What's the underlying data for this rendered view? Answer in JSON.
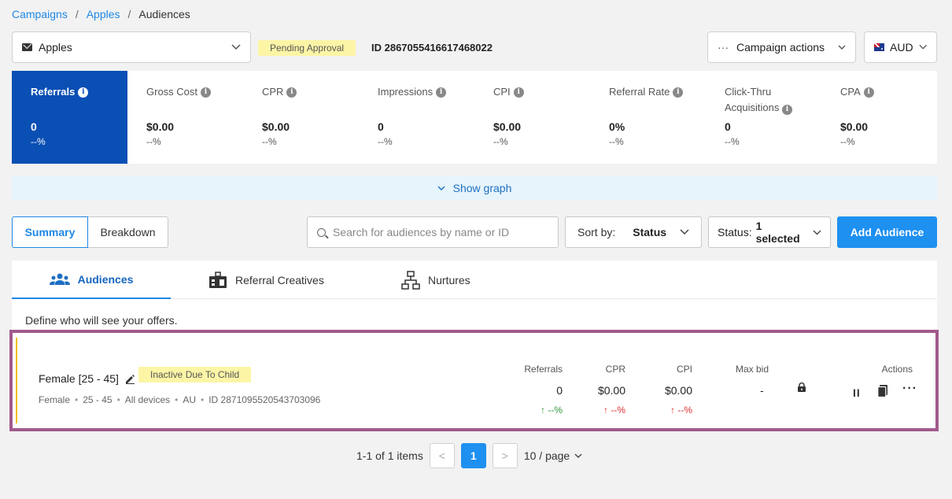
{
  "breadcrumb": {
    "item1": "Campaigns",
    "item2": "Apples",
    "item3": "Audiences",
    "sep": "/"
  },
  "header": {
    "campaign_name": "Apples",
    "status_badge": "Pending Approval",
    "campaign_id": "ID 2867055416617468022",
    "campaign_actions": "Campaign actions",
    "currency": "AUD",
    "more_glyph": "···"
  },
  "stats": [
    {
      "title": "Referrals",
      "value": "0",
      "delta": "--%"
    },
    {
      "title": "Gross Cost",
      "value": "$0.00",
      "delta": "--%"
    },
    {
      "title": "CPR",
      "value": "$0.00",
      "delta": "--%"
    },
    {
      "title": "Impressions",
      "value": "0",
      "delta": "--%"
    },
    {
      "title": "CPI",
      "value": "$0.00",
      "delta": "--%"
    },
    {
      "title": "Referral Rate",
      "value": "0%",
      "delta": "--%"
    },
    {
      "title": "Click-Thru Acquisitions",
      "value": "0",
      "delta": "--%"
    },
    {
      "title": "CPA",
      "value": "$0.00",
      "delta": "--%"
    }
  ],
  "show_graph": "Show graph",
  "toolbar": {
    "summary": "Summary",
    "breakdown": "Breakdown",
    "search_placeholder": "Search for audiences by name or ID",
    "sort_label": "Sort by:",
    "sort_value": "Status",
    "status_label": "Status:",
    "status_value": "1 selected",
    "add_audience": "Add Audience"
  },
  "tabs": {
    "audiences": "Audiences",
    "creatives": "Referral Creatives",
    "nurtures": "Nurtures"
  },
  "define_text": "Define who will see your offers.",
  "audience": {
    "name": "Female [25 - 45]",
    "status": "Inactive Due To Child",
    "meta": [
      "Female",
      "25 - 45",
      "All devices",
      "AU",
      "ID 2871095520543703096"
    ],
    "columns": {
      "referrals": {
        "head": "Referrals",
        "value": "0",
        "delta": "↑ --%"
      },
      "cpr": {
        "head": "CPR",
        "value": "$0.00",
        "delta": "↑ --%"
      },
      "cpi": {
        "head": "CPI",
        "value": "$0.00",
        "delta": "↑ --%"
      },
      "max_bid": {
        "head": "Max bid",
        "value": "-"
      },
      "actions": {
        "head": "Actions"
      }
    },
    "pause_glyph": "II",
    "more_glyph": "···"
  },
  "pagination": {
    "summary": "1-1 of 1 items",
    "prev": "<",
    "current": "1",
    "next": ">",
    "page_size": "10 / page"
  },
  "colors": {
    "accent": "#1e90f0",
    "active_stat": "#0a4fb4",
    "badge": "#fdf5a6",
    "highlight_border": "#a05a8c"
  },
  "icons": [
    "mail-icon",
    "chevron-down-icon",
    "info-icon",
    "search-icon",
    "users-icon",
    "creatives-icon",
    "nurtures-icon",
    "edit-icon",
    "lock-icon",
    "pause-icon",
    "copy-icon",
    "more-icon",
    "flag-icon"
  ]
}
